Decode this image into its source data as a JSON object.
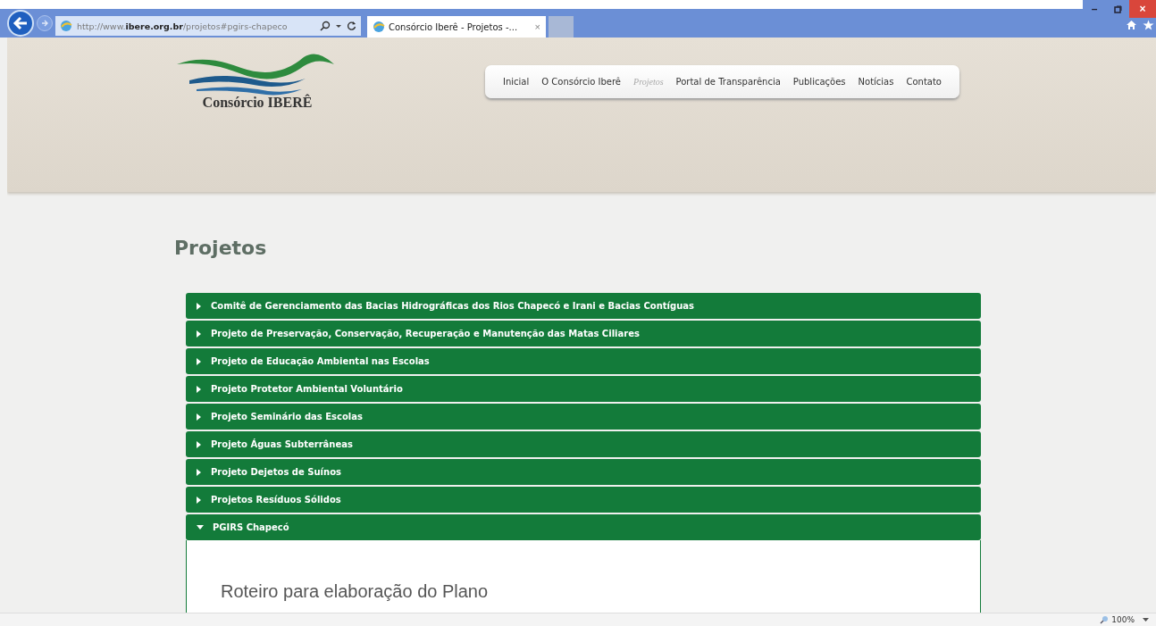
{
  "browser": {
    "address": "http://www.**ibere.org.br**/projetos#pgirs-chapeco",
    "tab_title": "Consórcio Iberê - Projetos -...",
    "tab_close": "×",
    "window_buttons": {
      "minimize": "–",
      "close": "×"
    },
    "zoom": "100%"
  },
  "site": {
    "logo_text": "Consórcio IBERÊ",
    "nav": [
      {
        "label": "Inicial",
        "selected": false
      },
      {
        "label": "O Consórcio Iberê",
        "selected": false
      },
      {
        "label": "Projetos",
        "selected": true
      },
      {
        "label": "Portal de Transparência",
        "selected": false
      },
      {
        "label": "Publicações",
        "selected": false
      },
      {
        "label": "Notícias",
        "selected": false
      },
      {
        "label": "Contato",
        "selected": false
      }
    ]
  },
  "page_title": "Projetos",
  "accordion": [
    {
      "title": "Comitê de Gerenciamento das Bacias Hidrográficas dos Rios Chapecó e Irani e Bacias Contíguas",
      "expanded": false
    },
    {
      "title": "Projeto de Preservação, Conservação, Recuperação e Manutenção das Matas Ciliares",
      "expanded": false
    },
    {
      "title": "Projeto de Educação Ambiental nas Escolas",
      "expanded": false
    },
    {
      "title": "Projeto Protetor Ambiental Voluntário",
      "expanded": false
    },
    {
      "title": "Projeto Seminário das Escolas",
      "expanded": false
    },
    {
      "title": "Projeto Águas Subterrâneas",
      "expanded": false
    },
    {
      "title": "Projeto Dejetos de Suínos",
      "expanded": false
    },
    {
      "title": "Projetos Resíduos Sólidos",
      "expanded": false
    },
    {
      "title": "PGIRS Chapecó",
      "expanded": true,
      "content_heading": "Roteiro para elaboração do Plano"
    }
  ]
}
